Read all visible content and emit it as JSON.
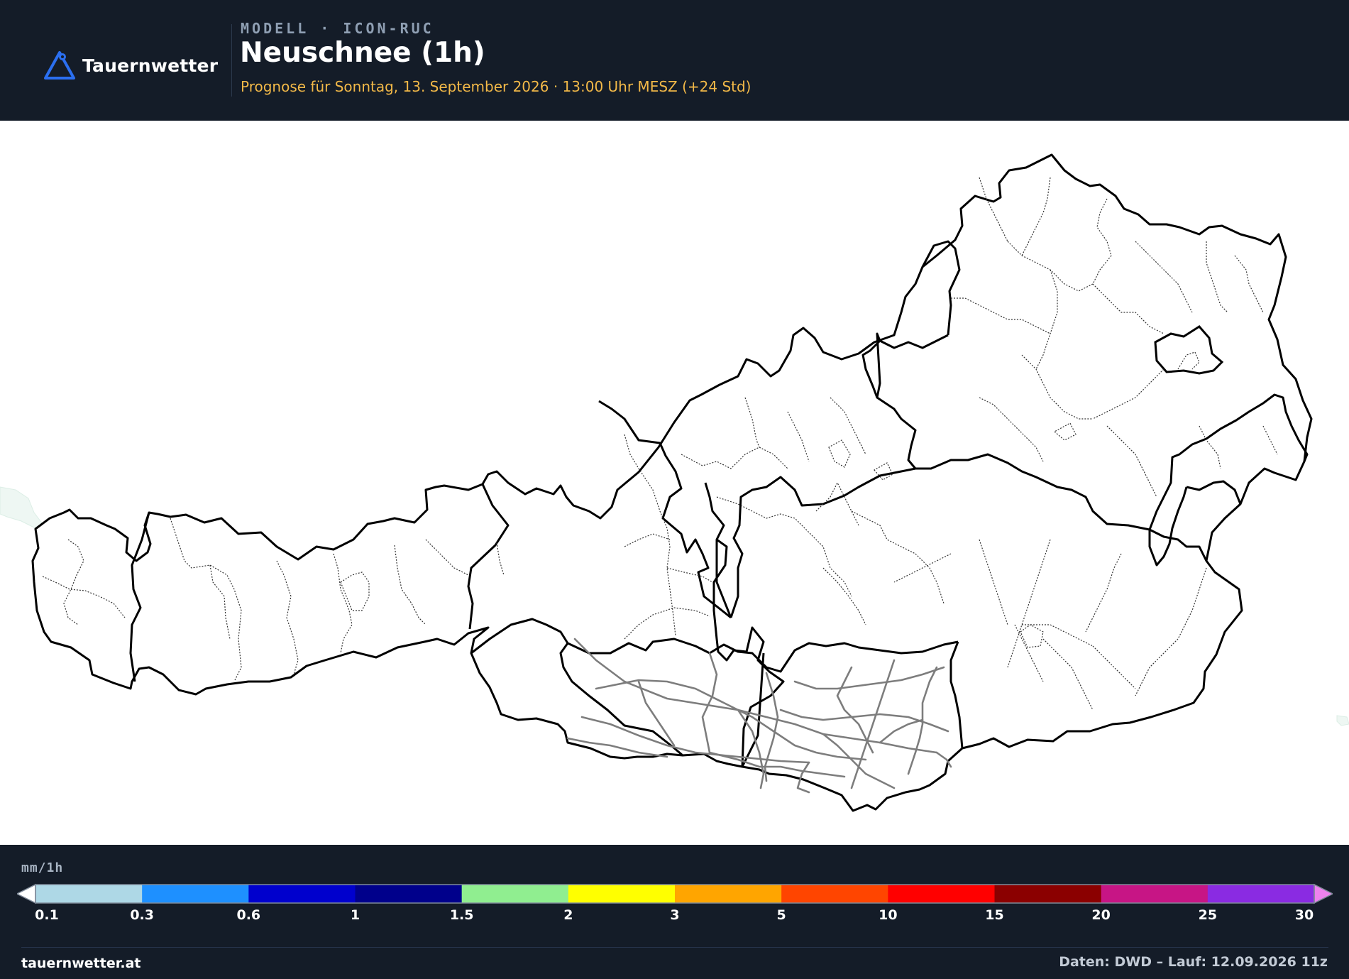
{
  "header": {
    "brand": "Tauernwetter",
    "model_label": "MODELL · ICON-RUC",
    "title": "Neuschnee (1h)",
    "subtitle": "Prognose für Sonntag, 13. September 2026 · 13:00 Uhr MESZ  (+24 Std)"
  },
  "icons": {
    "logo": "mountain-triangle-icon",
    "pin": "location-pin-icon"
  },
  "colors": {
    "header_bg": "#141c28",
    "accent": "#f3b948",
    "brand_blue": "#2b6ff0",
    "border": "#000000",
    "district_border": "#555555",
    "road": "#7d7d7d"
  },
  "legend": {
    "unit": "mm/1h",
    "ticks": [
      "0.1",
      "0.3",
      "0.6",
      "1",
      "1.5",
      "2",
      "3",
      "5",
      "10",
      "15",
      "20",
      "25",
      "30"
    ],
    "bins": [
      {
        "from": "0.1",
        "to": "0.3",
        "color": "#aed8e6"
      },
      {
        "from": "0.3",
        "to": "0.6",
        "color": "#1e90ff"
      },
      {
        "from": "0.6",
        "to": "1",
        "color": "#0000cd"
      },
      {
        "from": "1",
        "to": "1.5",
        "color": "#00008b"
      },
      {
        "from": "1.5",
        "to": "2",
        "color": "#90ee90"
      },
      {
        "from": "2",
        "to": "3",
        "color": "#ffff00"
      },
      {
        "from": "3",
        "to": "5",
        "color": "#ffa500"
      },
      {
        "from": "5",
        "to": "10",
        "color": "#ff4500"
      },
      {
        "from": "10",
        "to": "15",
        "color": "#ff0000"
      },
      {
        "from": "15",
        "to": "20",
        "color": "#8b0000"
      },
      {
        "from": "20",
        "to": "25",
        "color": "#c71585"
      },
      {
        "from": "25",
        "to": "30",
        "color": "#8a2be2"
      }
    ],
    "under_color": "#ffffff",
    "over_color": "#ee82ee"
  },
  "footer": {
    "site": "tauernwetter.at",
    "source": "Daten: DWD – Lauf: 12.09.2026 11z"
  }
}
